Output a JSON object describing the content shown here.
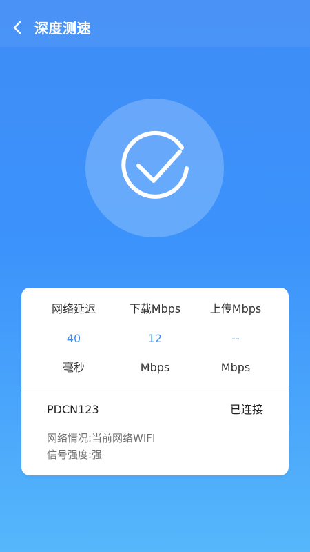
{
  "header": {
    "title": "深度测速",
    "back_icon": "chevron-left-icon"
  },
  "status": {
    "icon": "check-circle-icon",
    "color": "#ffffff"
  },
  "stats": [
    {
      "label": "网络延迟",
      "value": "40",
      "unit": "毫秒"
    },
    {
      "label": "下载Mbps",
      "value": "12",
      "unit": "Mbps"
    },
    {
      "label": "上传Mbps",
      "value": "--",
      "unit": "Mbps"
    }
  ],
  "network": {
    "ssid": "PDCN123",
    "connection_status": "已连接",
    "condition": "网络情况:当前网络WIFI",
    "signal_strength": "信号强度:强"
  },
  "colors": {
    "accent": "#3c8bf2",
    "background_top": "#3f8cf6",
    "background_bottom": "#56b7fb"
  }
}
